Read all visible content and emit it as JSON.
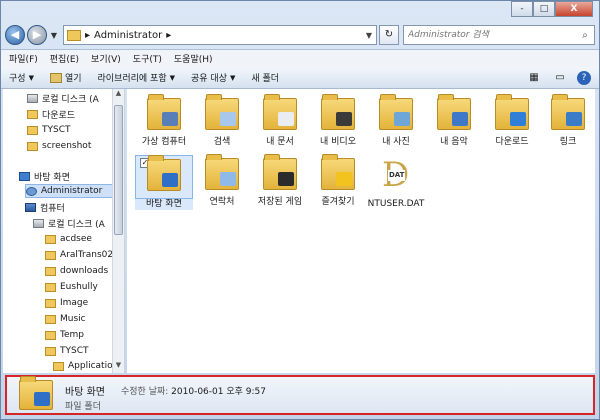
{
  "window": {
    "caption": [
      "-",
      "□",
      "X"
    ]
  },
  "address": {
    "path": "Administrator",
    "search_placeholder": "Administrator 검색"
  },
  "menu": [
    "파일(F)",
    "편집(E)",
    "보기(V)",
    "도구(T)",
    "도움말(H)"
  ],
  "commands": [
    "구성",
    "열기",
    "라이브러리에 포함",
    "공유 대상",
    "새 폴더"
  ],
  "nav": [
    {
      "label": "로컬 디스크 (A",
      "icon": "disk"
    },
    {
      "label": "다운로드",
      "icon": "folder"
    },
    {
      "label": "TYSCT",
      "icon": "folder"
    },
    {
      "label": "screenshot",
      "icon": "folder"
    },
    {
      "label": "바탕 화면",
      "icon": "desktop"
    },
    {
      "label": "Administrator",
      "icon": "user"
    },
    {
      "label": "컴퓨터",
      "icon": "computer"
    },
    {
      "label": "로컬 디스크 (A",
      "icon": "disk"
    },
    {
      "label": "acdsee",
      "icon": "folder"
    },
    {
      "label": "AralTrans02",
      "icon": "folder"
    },
    {
      "label": "downloads",
      "icon": "folder"
    },
    {
      "label": "Eushully",
      "icon": "folder"
    },
    {
      "label": "Image",
      "icon": "folder"
    },
    {
      "label": "Music",
      "icon": "folder"
    },
    {
      "label": "Temp",
      "icon": "folder"
    },
    {
      "label": "TYSCT",
      "icon": "folder"
    },
    {
      "label": "Application",
      "icon": "folder"
    }
  ],
  "items": [
    {
      "label": "가상 컴퓨터",
      "overlay": "#5a7fb8"
    },
    {
      "label": "검색",
      "overlay": "#a7c8ec"
    },
    {
      "label": "내 문서",
      "overlay": "#e9edf3"
    },
    {
      "label": "내 비디오",
      "overlay": "#3a3a3a"
    },
    {
      "label": "내 사진",
      "overlay": "#6ea6d8"
    },
    {
      "label": "내 음악",
      "overlay": "#3f78c8"
    },
    {
      "label": "다운로드",
      "overlay": "#2f7fd6"
    },
    {
      "label": "링크",
      "overlay": "#3b7cc9"
    },
    {
      "label": "바탕 화면",
      "overlay": "#2f6fc6"
    },
    {
      "label": "연락처",
      "overlay": "#8fb9e8"
    },
    {
      "label": "저장된 게임",
      "overlay": "#2b2b2b"
    },
    {
      "label": "즐겨찾기",
      "overlay": "#f2c21f"
    },
    {
      "label": "NTUSER.DAT",
      "overlay": ""
    }
  ],
  "dat_tag": "DAT",
  "details": {
    "name": "바탕 화면",
    "modified_label": "수정한 날짜:",
    "modified_value": "2010-06-01 오후 9:57",
    "type": "파일 폴더"
  }
}
